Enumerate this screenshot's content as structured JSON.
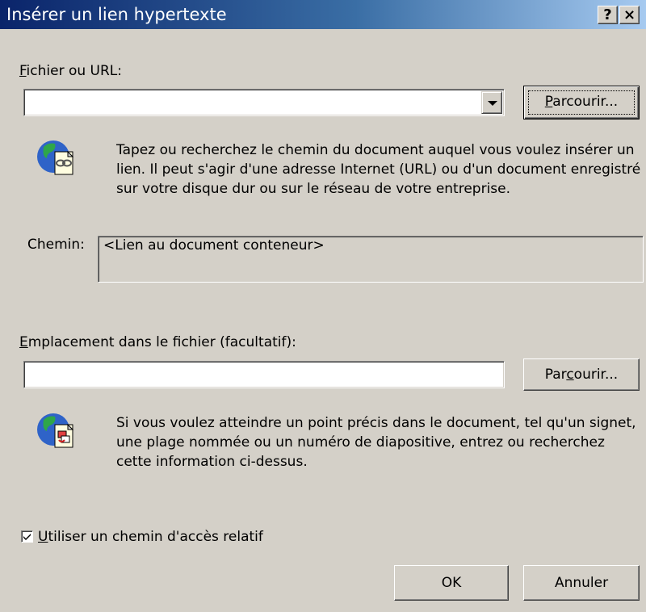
{
  "window": {
    "title": "Insérer un lien hypertexte",
    "help_glyph": "?",
    "close_glyph": "×"
  },
  "file_url": {
    "label_key": "F",
    "label_rest": "ichier ou URL:",
    "value": "",
    "browse": {
      "pre": "",
      "key": "P",
      "post": "arcourir..."
    }
  },
  "file_help": {
    "icon": "globe-document-link-icon",
    "text": "Tapez ou recherchez le chemin du document auquel vous voulez insérer un lien. Il peut s'agir d'une adresse Internet (URL) ou d'un document enregistré sur votre disque dur ou sur le réseau de votre entreprise."
  },
  "path": {
    "label": "Chemin:",
    "value": "<Lien au document conteneur>"
  },
  "location": {
    "label_key": "E",
    "label_rest": "mplacement dans le fichier (facultatif):",
    "value": "",
    "browse": {
      "pre": "Par",
      "key": "c",
      "post": "ourir..."
    }
  },
  "location_help": {
    "icon": "globe-document-bookmark-icon",
    "text": "Si vous voulez atteindre un point précis dans le document, tel qu'un signet, une plage nommée ou un numéro de diapositive, entrez ou recherchez cette information ci-dessus."
  },
  "relative_path": {
    "checked": true,
    "label_key": "U",
    "label_rest": "tiliser un chemin d'accès relatif"
  },
  "buttons": {
    "ok": "OK",
    "cancel": "Annuler"
  }
}
